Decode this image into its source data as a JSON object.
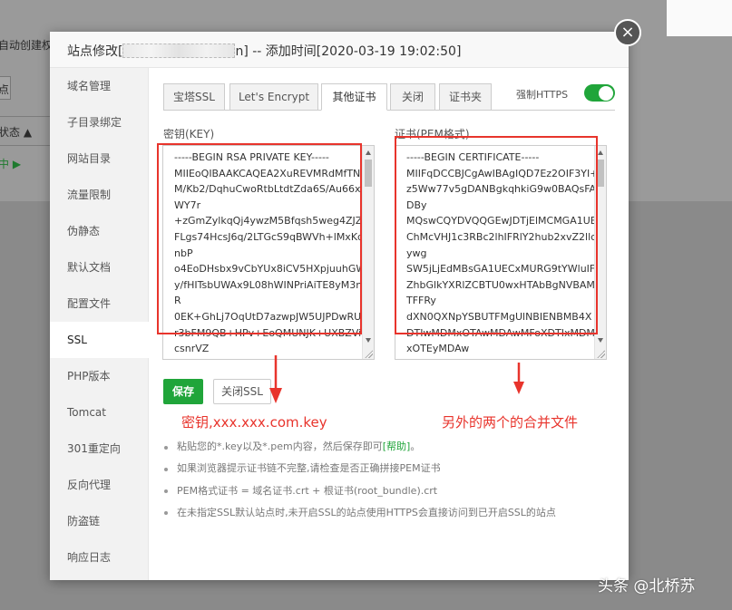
{
  "background": {
    "left_text_1": "自动创建权",
    "left_btn": "点",
    "left_status": "状态 ▲",
    "left_running": "中 ▶"
  },
  "dialog": {
    "title_prefix": "站点修改[",
    "title_suffix": "n] -- 添加时间[2020-03-19 19:02:50]",
    "close_symbol": "×"
  },
  "sidebar": {
    "items": [
      {
        "label": "域名管理"
      },
      {
        "label": "子目录绑定"
      },
      {
        "label": "网站目录"
      },
      {
        "label": "流量限制"
      },
      {
        "label": "伪静态"
      },
      {
        "label": "默认文档"
      },
      {
        "label": "配置文件"
      },
      {
        "label": "SSL"
      },
      {
        "label": "PHP版本"
      },
      {
        "label": "Tomcat"
      },
      {
        "label": "301重定向"
      },
      {
        "label": "反向代理"
      },
      {
        "label": "防盗链"
      },
      {
        "label": "响应日志"
      }
    ],
    "active": "SSL"
  },
  "tabs": {
    "items": [
      {
        "label": "宝塔SSL"
      },
      {
        "label": "Let's Encrypt"
      },
      {
        "label": "其他证书"
      },
      {
        "label": "关闭"
      },
      {
        "label": "证书夹"
      }
    ],
    "active": "其他证书"
  },
  "https": {
    "label": "强制HTTPS",
    "enabled": true
  },
  "key_field": {
    "label": "密钥(KEY)",
    "value": "-----BEGIN RSA PRIVATE KEY-----\nMIIEoQIBAAKCAQEA2XuREVMRdMfTNM/Kb2/DqhuCwoRtbLtdtZda6S/Au66xWY7r\n+zGmZylkqQj4ywzM5Bfqsh5weg4ZJZFLgs74HcsJ6q/2LTGcS9qBWVh+lMxKdnbP\no4EoDHsbx9vCbYUx8iCV5HXpjuuhGWy/fHITsbUWAx9L08hWINPriAiTE8yM3niR\n0EK+GhLj7OqUtD7azwpJW5UJPDwRUsr3bFM9QB+HPv+EoQMUNJK+UXBZVicsnrVZ"
  },
  "cert_field": {
    "label": "证书(PEM格式)",
    "value": "-----BEGIN CERTIFICATE-----\nMIIFqDCCBJCgAwIBAgIQD7Ez2OIF3YI+z5Ww77v5gDANBgkqhkiG9w0BAQsFADBy\nMQswCQYDVQQGEwJDTjElMCMGA1UEChMcVHJ1c3RBc2lhIFRlY2hub2xvZ2llcywg\nSW5jLjEdMBsGA1UECxMURG9tYWluIFZhbGlkYXRlZCBTU0wxHTAbBgNVBAMTFFRy\ndXN0QXNpYSBUTFMgUlNBIENBMB4XDTIwMDMxOTAwMDAwMFoXDTIxMDMxOTEyMDAw"
  },
  "buttons": {
    "save": "保存",
    "close_ssl": "关闭SSL"
  },
  "annotations": {
    "key_note": "密钥,xxx.xxx.com.key",
    "cert_note": "另外的两个的合并文件"
  },
  "tips": {
    "tip1_text": "粘贴您的*.key以及*.pem内容，然后保存即可",
    "tip1_link": "[帮助]",
    "tip1_end": "。",
    "tip2": "如果浏览器提示证书链不完整,请检查是否正确拼接PEM证书",
    "tip3": "PEM格式证书 = 域名证书.crt + 根证书(root_bundle).crt",
    "tip4": "在未指定SSL默认站点时,未开启SSL的站点使用HTTPS会直接访问到已开启SSL的站点"
  },
  "watermark": "头条 @北桥苏",
  "colors": {
    "accent_green": "#20a53a",
    "annotation_red": "#e8342c"
  }
}
